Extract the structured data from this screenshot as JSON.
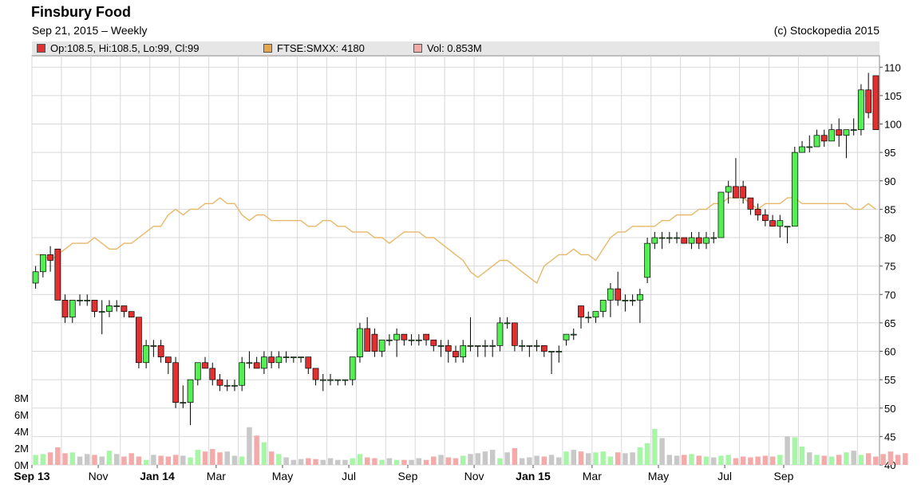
{
  "header": {
    "title": "Finsbury Food",
    "subtitle": "Sep 21, 2015 – Weekly",
    "copyright": "(c) Stockopedia 2015"
  },
  "legend": {
    "price": "Op:108.5, Hi:108.5, Lo:99, Cl:99",
    "index": "FTSE:SMXX: 4180",
    "volume": "Vol: 0.853M"
  },
  "colors": {
    "up": "#55ee55",
    "down": "#e03030",
    "index_line": "#e8b86a",
    "vol_up": "#a8f5a8",
    "vol_down": "#f5aaaa",
    "vol_neutral": "#c8c8c8",
    "grid": "#d8d8d8"
  },
  "chart_data": {
    "type": "candlestick",
    "x_tick_labels": [
      "Sep 13",
      "Nov",
      "Jan 14",
      "Mar",
      "May",
      "Jul",
      "Sep",
      "Nov",
      "Jan 15",
      "Mar",
      "May",
      "Jul",
      "Sep"
    ],
    "x_tick_weeks": [
      0,
      9,
      17,
      25,
      34,
      43,
      51,
      60,
      68,
      76,
      85,
      94,
      102
    ],
    "ylim": [
      40,
      112
    ],
    "y_ticks": [
      40,
      45,
      50,
      55,
      60,
      65,
      70,
      75,
      80,
      85,
      90,
      95,
      100,
      105,
      110
    ],
    "volume_ticks": [
      "0M",
      "2M",
      "4M",
      "6M",
      "8M"
    ],
    "volume_max_millions": 10,
    "ohlc": [
      [
        72,
        75,
        71,
        74
      ],
      [
        74,
        77,
        73,
        77
      ],
      [
        77,
        78.5,
        74,
        76
      ],
      [
        78,
        78,
        69,
        69
      ],
      [
        69,
        70,
        65,
        66
      ],
      [
        66,
        69,
        65,
        69
      ],
      [
        69,
        70,
        68,
        69
      ],
      [
        69,
        70,
        68,
        69
      ],
      [
        69,
        69,
        66,
        67
      ],
      [
        67,
        69,
        63,
        67
      ],
      [
        67,
        69,
        66,
        68
      ],
      [
        68,
        69,
        67,
        68
      ],
      [
        68,
        68,
        66,
        67
      ],
      [
        67,
        67,
        66,
        66
      ],
      [
        66,
        66,
        57,
        58
      ],
      [
        58,
        62,
        57,
        61
      ],
      [
        61,
        62,
        59,
        61
      ],
      [
        61,
        62,
        58,
        59
      ],
      [
        59,
        59,
        56,
        58
      ],
      [
        58,
        59,
        50,
        51
      ],
      [
        51,
        54,
        50,
        51
      ],
      [
        51,
        55,
        47,
        55
      ],
      [
        55,
        58,
        54,
        58
      ],
      [
        58,
        59,
        57,
        57
      ],
      [
        57,
        58,
        54,
        55
      ],
      [
        55,
        56,
        53,
        54
      ],
      [
        54,
        55,
        53,
        54
      ],
      [
        54,
        55,
        53,
        54
      ],
      [
        54,
        59,
        53,
        58
      ],
      [
        58,
        60,
        57,
        58
      ],
      [
        58,
        59,
        57,
        57
      ],
      [
        57,
        60,
        56,
        59
      ],
      [
        59,
        60,
        57,
        58
      ],
      [
        58,
        60,
        57,
        59
      ],
      [
        59,
        60,
        58,
        59
      ],
      [
        59,
        59,
        58,
        59
      ],
      [
        59,
        59,
        58,
        59
      ],
      [
        59,
        59,
        56,
        57
      ],
      [
        57,
        57,
        54,
        55
      ],
      [
        55,
        56,
        53,
        55
      ],
      [
        55,
        56,
        54,
        55
      ],
      [
        55,
        55,
        54,
        55
      ],
      [
        55,
        55,
        54,
        55
      ],
      [
        55,
        59,
        54,
        59
      ],
      [
        59,
        65,
        58,
        64
      ],
      [
        64,
        66,
        60,
        60
      ],
      [
        63,
        64,
        59,
        60
      ],
      [
        60,
        62,
        59,
        62
      ],
      [
        62,
        63,
        61,
        62
      ],
      [
        62,
        64,
        59,
        63
      ],
      [
        63,
        63,
        61,
        62
      ],
      [
        62,
        63,
        61,
        62
      ],
      [
        62,
        63,
        61,
        62
      ],
      [
        63,
        63,
        61,
        62
      ],
      [
        62,
        62,
        60,
        61
      ],
      [
        61,
        62,
        59,
        61
      ],
      [
        61,
        62,
        58,
        60
      ],
      [
        60,
        61,
        58,
        59
      ],
      [
        59,
        62,
        58,
        61
      ],
      [
        61,
        66,
        60,
        61
      ],
      [
        61,
        61,
        59,
        61
      ],
      [
        61,
        62,
        59,
        61
      ],
      [
        61,
        62,
        59,
        61
      ],
      [
        61,
        66,
        60,
        65
      ],
      [
        65,
        66,
        64,
        65
      ],
      [
        65,
        65,
        60,
        61
      ],
      [
        61,
        62,
        60,
        61
      ],
      [
        61,
        61,
        59,
        61
      ],
      [
        61,
        62,
        60,
        61
      ],
      [
        61,
        61,
        59,
        60
      ],
      [
        60,
        60,
        56,
        60
      ],
      [
        60,
        61,
        58,
        60
      ],
      [
        62,
        63,
        61,
        63
      ],
      [
        63,
        64,
        62,
        63
      ],
      [
        68,
        68,
        64,
        66
      ],
      [
        66,
        67,
        65,
        66
      ],
      [
        66,
        67,
        65,
        67
      ],
      [
        67,
        69,
        66,
        69
      ],
      [
        69,
        72,
        66,
        71
      ],
      [
        71,
        74,
        68,
        69
      ],
      [
        69,
        70,
        67,
        69
      ],
      [
        69,
        70,
        68,
        69
      ],
      [
        69,
        71,
        65,
        70
      ],
      [
        73,
        80,
        72,
        79
      ],
      [
        79,
        81,
        78,
        80
      ],
      [
        80,
        81,
        78,
        80
      ],
      [
        80,
        81,
        79,
        80
      ],
      [
        80,
        81,
        79,
        80
      ],
      [
        80,
        80,
        79,
        79
      ],
      [
        79,
        81,
        78,
        80
      ],
      [
        80,
        81,
        78,
        79
      ],
      [
        79,
        81,
        78,
        80
      ],
      [
        80,
        81,
        79,
        80
      ],
      [
        80,
        88,
        80,
        88
      ],
      [
        88,
        90,
        86,
        89
      ],
      [
        89,
        94,
        87,
        87
      ],
      [
        89,
        90,
        86,
        87
      ],
      [
        87,
        87,
        84,
        85
      ],
      [
        85,
        86,
        83,
        84
      ],
      [
        84,
        85,
        82,
        83
      ],
      [
        83,
        84,
        82,
        82
      ],
      [
        82,
        84,
        80,
        83
      ],
      [
        82,
        82,
        79,
        82
      ],
      [
        82,
        96,
        82,
        95
      ],
      [
        95,
        97,
        95,
        96
      ],
      [
        96,
        98,
        95,
        96
      ],
      [
        96,
        99,
        96,
        98
      ],
      [
        98,
        99,
        96,
        97
      ],
      [
        97,
        100,
        97,
        99
      ],
      [
        99,
        101,
        96,
        98
      ],
      [
        98,
        99,
        94,
        99
      ],
      [
        99,
        101,
        98,
        99
      ],
      [
        99,
        107,
        98,
        106
      ],
      [
        106,
        109,
        101,
        102
      ],
      [
        108.5,
        108.5,
        99,
        99
      ]
    ],
    "index_close": [
      77,
      77,
      76,
      77,
      78,
      79,
      79,
      79,
      80,
      79,
      78,
      78,
      79,
      79,
      80,
      81,
      82,
      82,
      84,
      85,
      84,
      85,
      85,
      86,
      86,
      87,
      86,
      86,
      84,
      83,
      84,
      84,
      83,
      83,
      83,
      83,
      83,
      82,
      82,
      83,
      83,
      82,
      82,
      81,
      81,
      81,
      80,
      80,
      79,
      80,
      81,
      81,
      81,
      80,
      80,
      79,
      78,
      77,
      76,
      74,
      73,
      74,
      75,
      76,
      76,
      75,
      74,
      73,
      72,
      75,
      76,
      77,
      77,
      78,
      77,
      77,
      76,
      78,
      80,
      81,
      81,
      82,
      82,
      82,
      82,
      83,
      83,
      84,
      84,
      84,
      85,
      85,
      86,
      86,
      87,
      87,
      87,
      86,
      85,
      86,
      86,
      86,
      87,
      87,
      86,
      86,
      86,
      86,
      86,
      86,
      86,
      85,
      85,
      86,
      85
    ],
    "volume_millions": [
      1.2,
      1.3,
      1.5,
      2.1,
      1.4,
      1.5,
      1.0,
      1.3,
      1.2,
      1.0,
      1.7,
      1.3,
      1.0,
      1.4,
      1.0,
      0.6,
      1.2,
      1.1,
      1.0,
      1.2,
      1.1,
      0.9,
      1.8,
      1.6,
      1.9,
      1.5,
      1.6,
      1.1,
      1.0,
      4.5,
      3.5,
      2.7,
      1.6,
      1.3,
      0.9,
      0.6,
      0.7,
      0.8,
      0.7,
      0.6,
      0.8,
      0.6,
      0.6,
      0.8,
      1.3,
      0.9,
      0.8,
      0.6,
      0.8,
      0.6,
      0.6,
      0.6,
      0.8,
      0.6,
      1.0,
      1.2,
      0.9,
      0.8,
      1.1,
      1.3,
      1.4,
      1.6,
      1.8,
      0.8,
      1.5,
      2.0,
      0.8,
      0.9,
      1.1,
      1.0,
      1.2,
      0.9,
      1.6,
      1.8,
      1.6,
      1.4,
      1.5,
      1.6,
      1.0,
      1.5,
      1.4,
      1.5,
      2.1,
      2.6,
      4.3,
      3.2,
      1.2,
      1.1,
      1.2,
      1.3,
      1.1,
      1.0,
      0.9,
      1.1,
      1.2,
      0.8,
      1.0,
      0.9,
      1.0,
      1.1,
      1.0,
      1.2,
      3.4,
      3.3,
      2.2,
      1.5,
      1.2,
      1.1,
      1.0,
      1.2,
      1.5,
      1.7,
      1.2,
      1.4,
      1.0,
      1.3,
      1.6,
      1.2,
      1.4
    ]
  }
}
